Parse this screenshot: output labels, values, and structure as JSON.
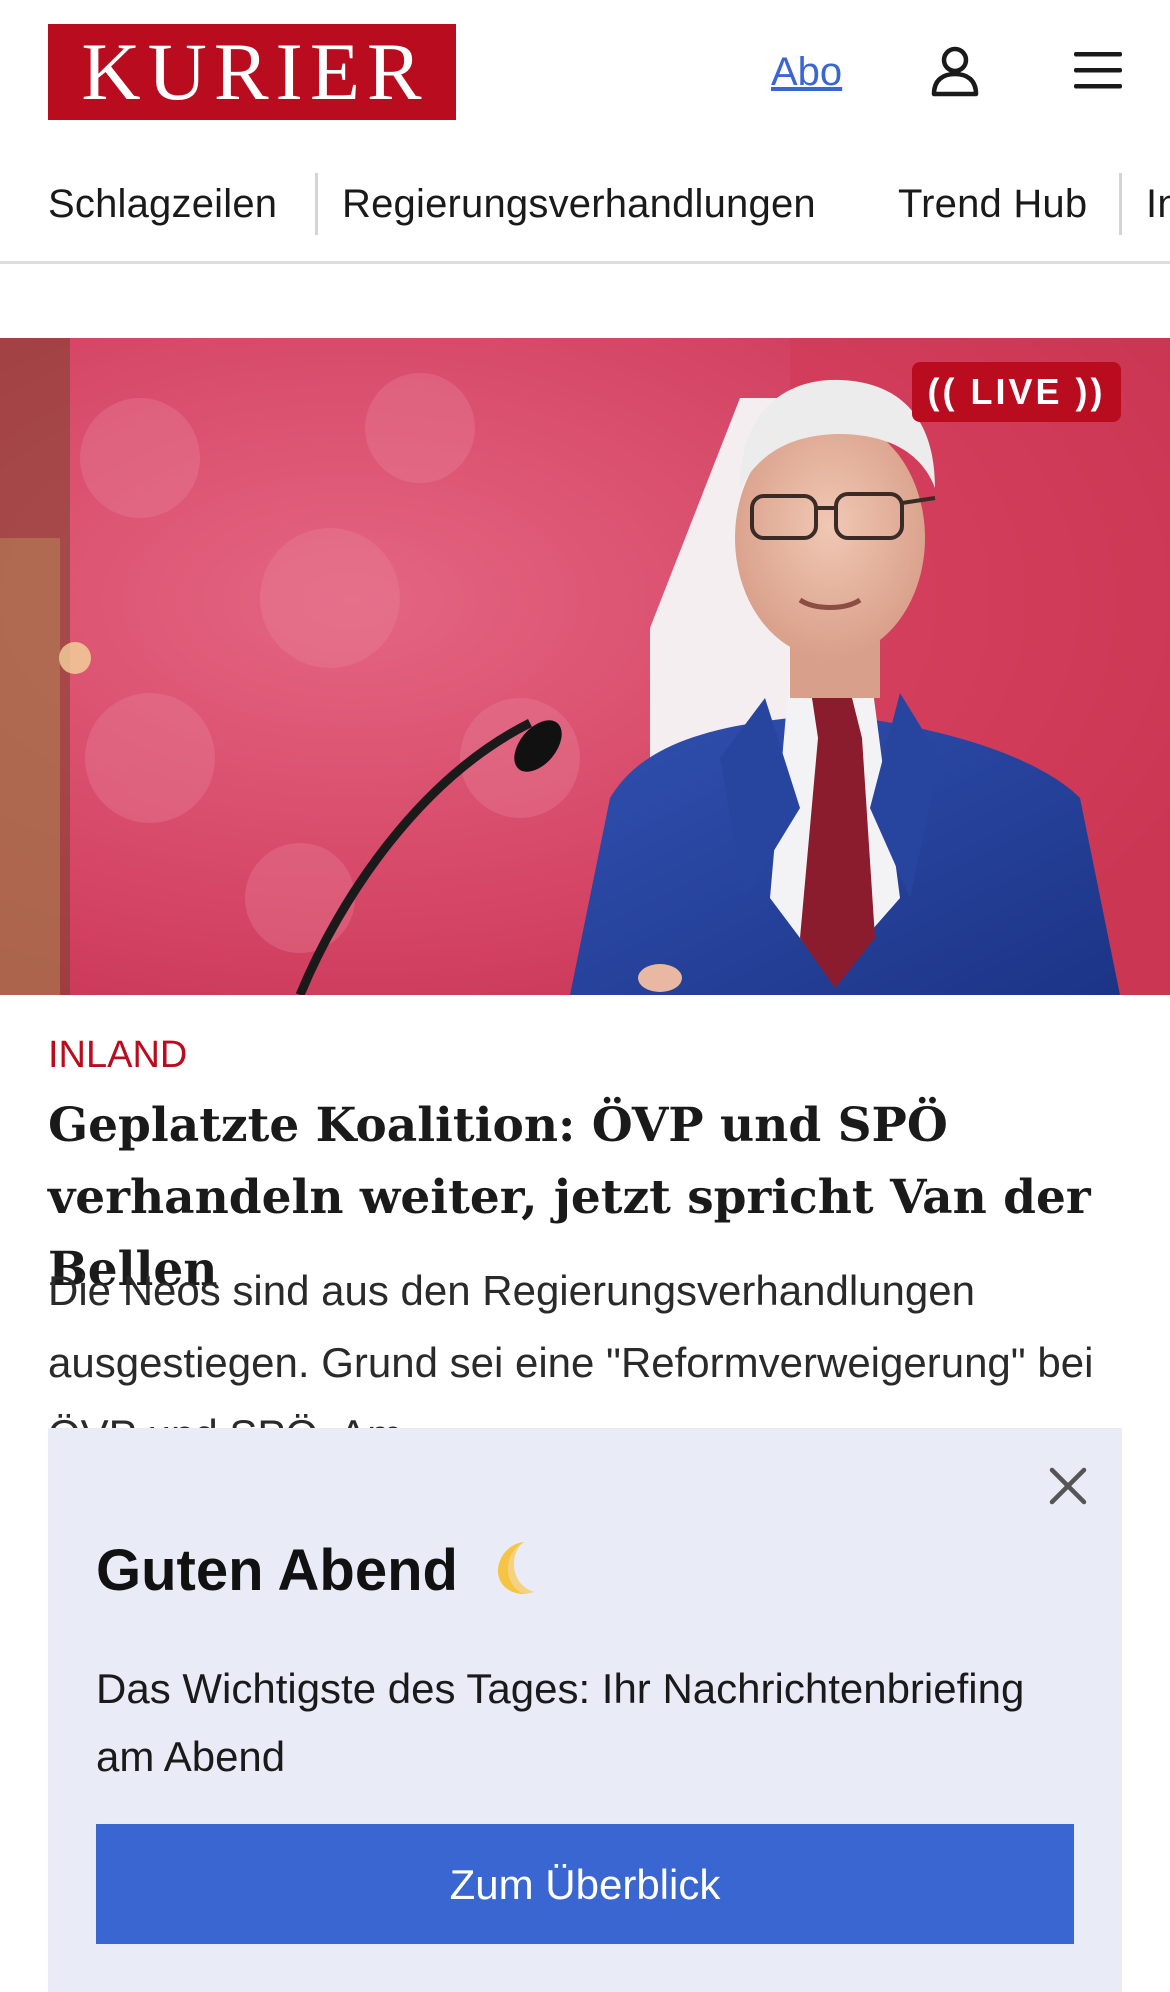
{
  "header": {
    "logo_text": "KURIER",
    "abo_label": "Abo",
    "brand_color": "#b90d1f",
    "link_color": "#3a66d1",
    "icons": [
      "user-icon",
      "menu-icon"
    ]
  },
  "nav": {
    "items": [
      {
        "label": "Schlagzeilen"
      },
      {
        "label": "Regierungsverhandlungen"
      },
      {
        "label": "Trend Hub"
      },
      {
        "label": "In"
      }
    ]
  },
  "hero": {
    "badge": "LIVE",
    "badge_icons": [
      "live-signal-left-icon",
      "live-signal-right-icon"
    ]
  },
  "article": {
    "kicker": "INLAND",
    "headline": "Geplatzte Koalition: ÖVP und SPÖ verhan­deln weiter, jetzt spricht Van der Bellen",
    "teaser": "Die Neos sind aus den Regierungsverhandlungen ausgestiegen. Grund sei eine \"Reformverweigerung\" bei ÖVP und SPÖ. Am"
  },
  "popup": {
    "title": "Guten Abend",
    "title_emoji": "🌙",
    "text": "Das Wichtigste des Tages: Ihr Nachrichtenbriefing am Abend",
    "button_label": "Zum Überblick",
    "button_color": "#3a66d1",
    "background_color": "#e9ecf7"
  }
}
